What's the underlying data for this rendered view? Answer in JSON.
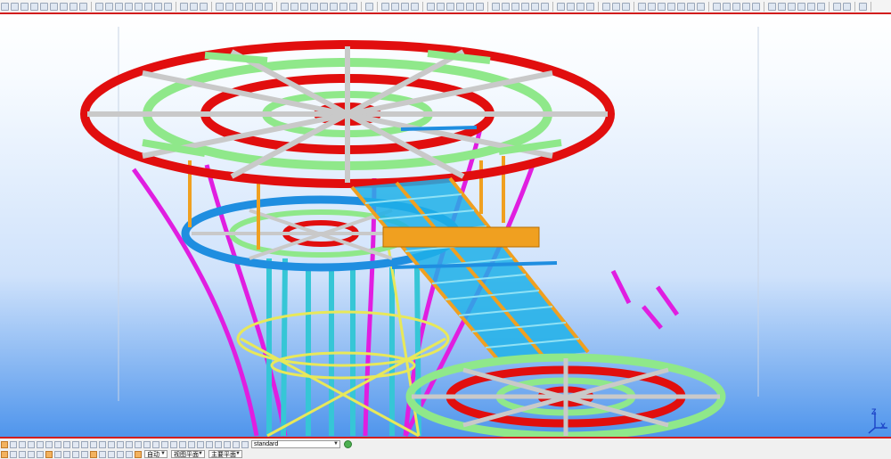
{
  "toolbar": {
    "groups": [
      9,
      8,
      3,
      6,
      8,
      1,
      4,
      6,
      6,
      4,
      3,
      7,
      5,
      6,
      2,
      1
    ]
  },
  "viewport": {
    "name": "3D model view",
    "axis": {
      "z": "Z",
      "x": "X"
    },
    "colors": {
      "red_members": "#e10e0e",
      "green_members": "#8fe88a",
      "grey_members": "#c9c9c9",
      "blue_members": "#1f8ee0",
      "cyan_members": "#36c6d6",
      "magenta_members": "#e01ee0",
      "orange_members": "#f0a020",
      "yellow_members": "#e8e85a"
    }
  },
  "bottom": {
    "row1_button_count": 28,
    "view_select": {
      "value": "standard"
    },
    "row2": {
      "select_a": "自动",
      "select_b": "视图平面",
      "select_c": "主要平面"
    }
  }
}
